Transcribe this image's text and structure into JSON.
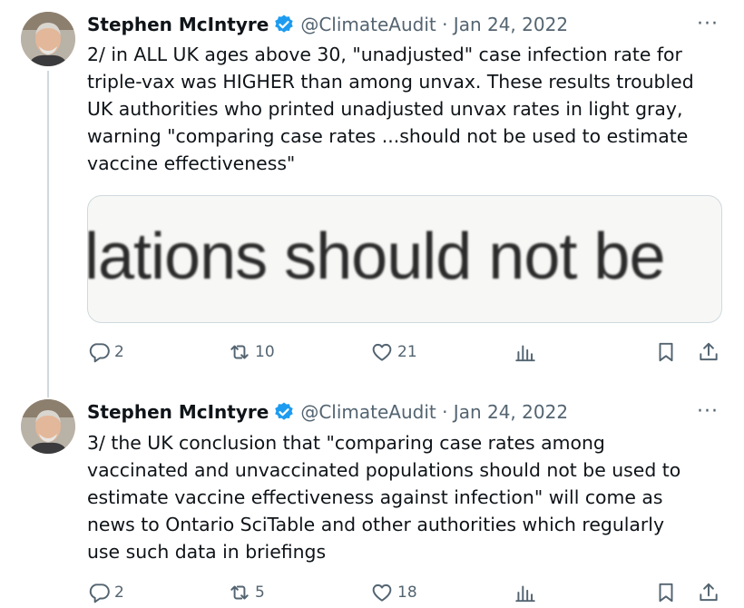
{
  "tweets": [
    {
      "author_name": "Stephen McIntyre",
      "handle_date": "@ClimateAudit · Jan 24, 2022",
      "more": "···",
      "text": "2/ in ALL UK ages above 30, \"unadjusted\" case infection rate for\ntriple-vax was HIGHER than among unvax. These results troubled\nUK authorities who printed unadjusted unvax rates in light gray,\nwarning \"comparing case rates ...should not be used to estimate\nvaccine effectiveness\"",
      "media_text": "lations should not be",
      "replies": "2",
      "reposts": "10",
      "likes": "21"
    },
    {
      "author_name": "Stephen McIntyre",
      "handle_date": "@ClimateAudit · Jan 24, 2022",
      "more": "···",
      "text": "3/ the UK conclusion that \"comparing case rates among\nvaccinated and unvaccinated populations should not be used to\nestimate vaccine effectiveness against infection\" will come as\nnews to Ontario SciTable and other authorities which regularly\nuse such data in briefings",
      "replies": "2",
      "reposts": "5",
      "likes": "18"
    }
  ],
  "colors": {
    "verified": "#1d9bf0",
    "secondary": "#536471",
    "divider": "#cfd9de"
  }
}
